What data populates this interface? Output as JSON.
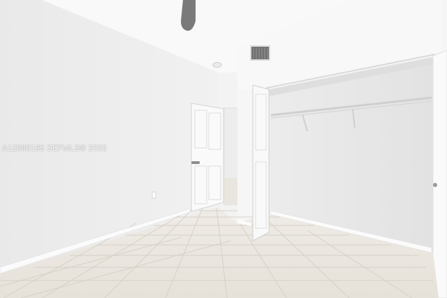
{
  "watermark": {
    "text": "A12086195  SEFMLS© 2026"
  },
  "colors": {
    "wall_left": "#eeeeee",
    "wall_right": "#f7f7f7",
    "ceiling": "#f9f9f9",
    "floor": "#ebe7e1",
    "grout": "#d9d4cc",
    "door": "#fafafa",
    "door_panel_line": "#dcdcdc"
  },
  "objects": {
    "ceiling_fan": "ceiling-fan-blade",
    "vent": "air-vent",
    "smoke_detector": "smoke-detector",
    "bedroom_door": "open-panel-door",
    "closet_door": "open-closet-door",
    "closet_shelf": "wire-shelf"
  }
}
